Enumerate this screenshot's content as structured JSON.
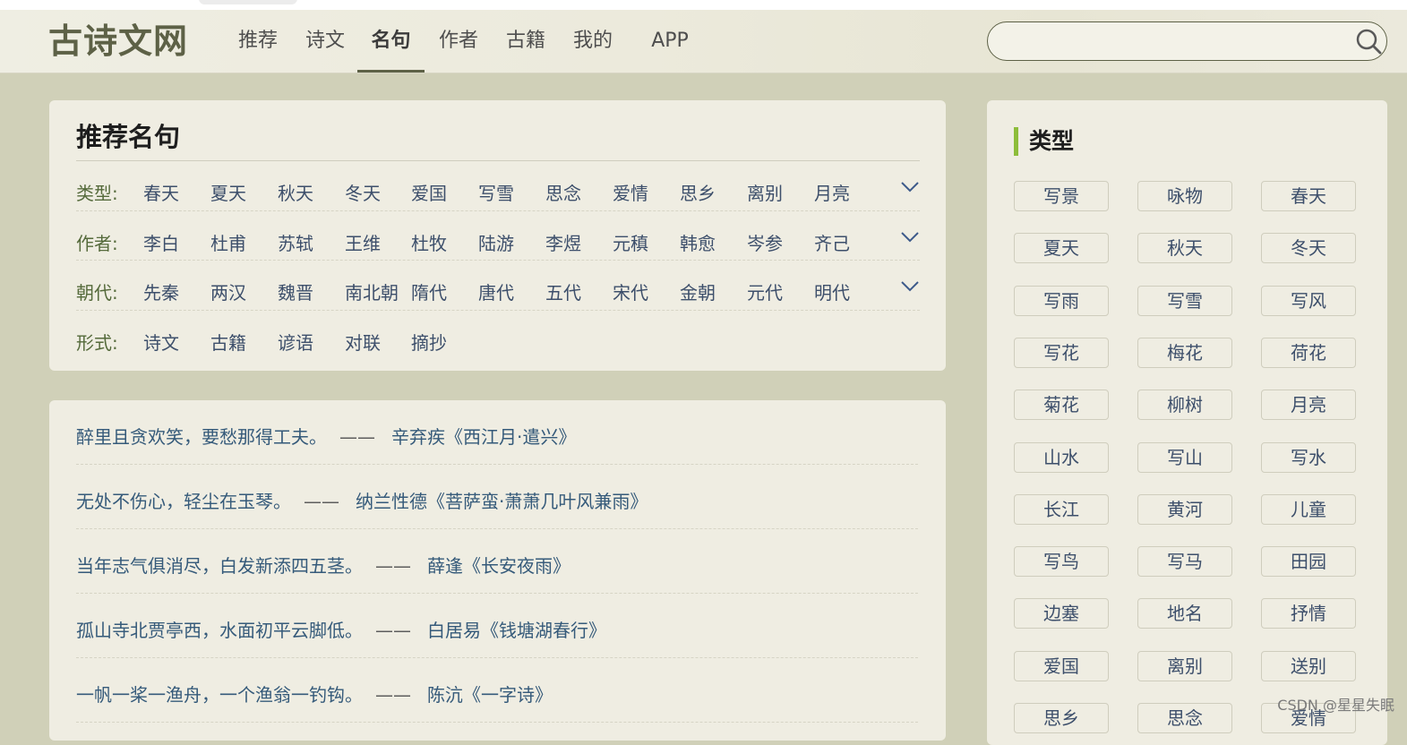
{
  "header": {
    "logo": "古诗文网",
    "nav": [
      {
        "label": "推荐",
        "active": false
      },
      {
        "label": "诗文",
        "active": false
      },
      {
        "label": "名句",
        "active": true
      },
      {
        "label": "作者",
        "active": false
      },
      {
        "label": "古籍",
        "active": false
      },
      {
        "label": "我的",
        "active": false
      },
      {
        "label": "APP",
        "active": false
      }
    ],
    "search": {
      "placeholder": "",
      "value": ""
    }
  },
  "recommend": {
    "title": "推荐名句",
    "rows": [
      {
        "label": "类型:",
        "items": [
          "春天",
          "夏天",
          "秋天",
          "冬天",
          "爱国",
          "写雪",
          "思念",
          "爱情",
          "思乡",
          "离别",
          "月亮"
        ],
        "expandable": true
      },
      {
        "label": "作者:",
        "items": [
          "李白",
          "杜甫",
          "苏轼",
          "王维",
          "杜牧",
          "陆游",
          "李煜",
          "元稹",
          "韩愈",
          "岑参",
          "齐己"
        ],
        "expandable": true
      },
      {
        "label": "朝代:",
        "items": [
          "先秦",
          "两汉",
          "魏晋",
          "南北朝",
          "隋代",
          "唐代",
          "五代",
          "宋代",
          "金朝",
          "元代",
          "明代"
        ],
        "expandable": true
      },
      {
        "label": "形式:",
        "items": [
          "诗文",
          "古籍",
          "谚语",
          "对联",
          "摘抄"
        ],
        "expandable": false
      }
    ]
  },
  "quotes": [
    {
      "text": "醉里且贪欢笑，要愁那得工夫。",
      "dash": "——",
      "source": "辛弃疾《西江月·遣兴》"
    },
    {
      "text": "无处不伤心，轻尘在玉琴。",
      "dash": "——",
      "source": "纳兰性德《菩萨蛮·萧萧几叶风兼雨》"
    },
    {
      "text": "当年志气俱消尽，白发新添四五茎。",
      "dash": "——",
      "source": "薛逢《长安夜雨》"
    },
    {
      "text": "孤山寺北贾亭西，水面初平云脚低。",
      "dash": "——",
      "source": "白居易《钱塘湖春行》"
    },
    {
      "text": "一帆一桨一渔舟，一个渔翁一钓钩。",
      "dash": "——",
      "source": "陈沆《一字诗》"
    }
  ],
  "sidebar": {
    "title": "类型",
    "tags": [
      "写景",
      "咏物",
      "春天",
      "夏天",
      "秋天",
      "冬天",
      "写雨",
      "写雪",
      "写风",
      "写花",
      "梅花",
      "荷花",
      "菊花",
      "柳树",
      "月亮",
      "山水",
      "写山",
      "写水",
      "长江",
      "黄河",
      "儿童",
      "写鸟",
      "写马",
      "田园",
      "边塞",
      "地名",
      "抒情",
      "爱国",
      "离别",
      "送别",
      "思乡",
      "思念",
      "爱情"
    ]
  },
  "watermark": "CSDN @星星失眠",
  "colors": {
    "accent": "#5d6146",
    "link": "#3d4f6b",
    "label": "#556a3b",
    "sidebar_bar": "#8dbd3a"
  }
}
